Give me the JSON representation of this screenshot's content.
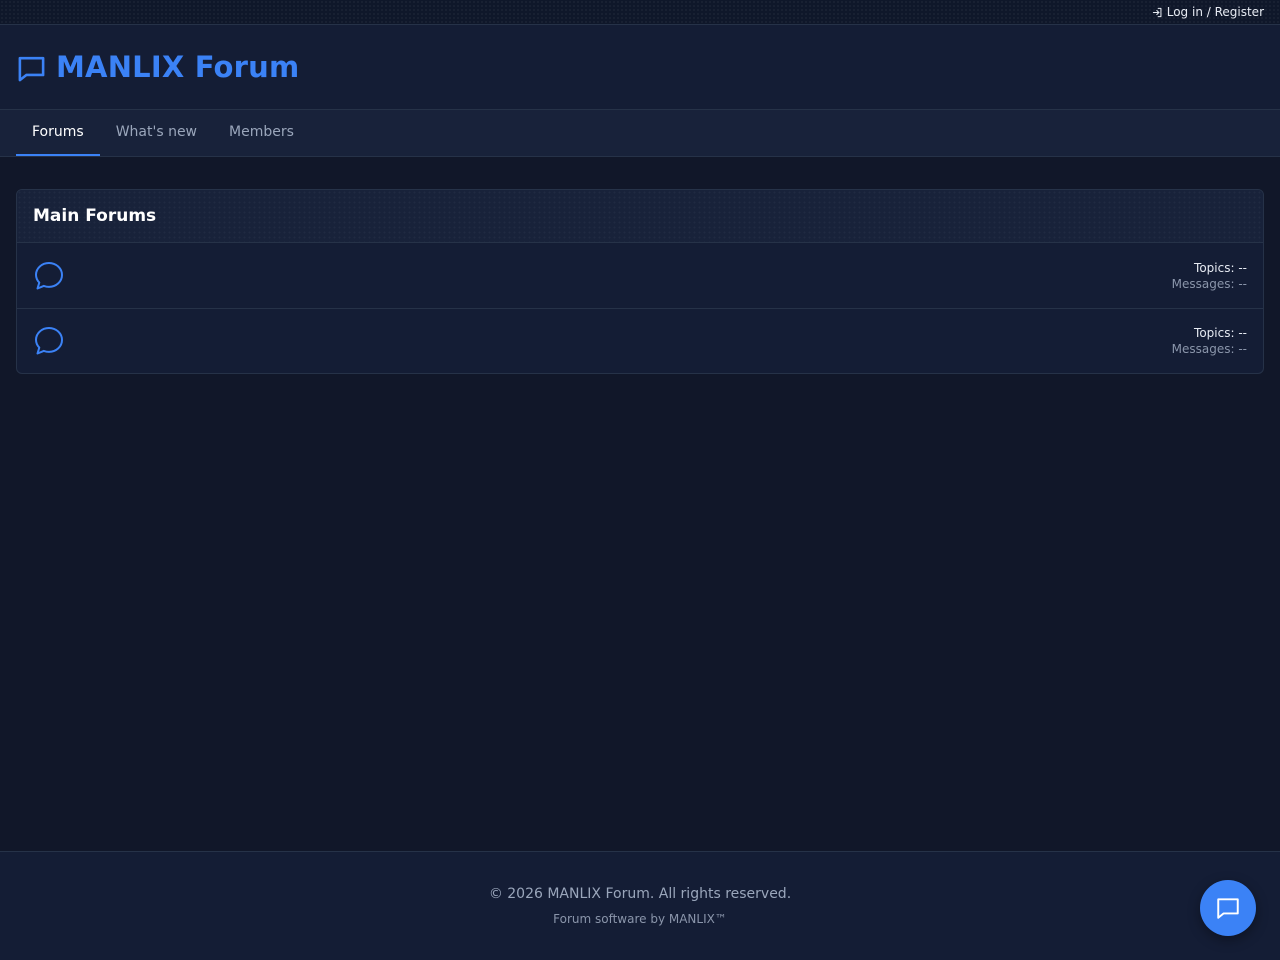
{
  "topbar": {
    "login_label": "Log in / Register",
    "login_icon": "login-icon"
  },
  "header": {
    "site_title": "MANLIX Forum",
    "logo_icon": "chat-bubble-icon",
    "brand_color": "#3b82f6"
  },
  "nav": {
    "tabs": [
      {
        "label": "Forums",
        "active": true
      },
      {
        "label": "What's new",
        "active": false
      },
      {
        "label": "Members",
        "active": false
      }
    ]
  },
  "main": {
    "section_title": "Main Forums",
    "forums": [
      {
        "icon": "chat-bubble-icon",
        "topics": "Topics: --",
        "messages": "Messages: --"
      },
      {
        "icon": "chat-bubble-icon",
        "topics": "Topics: --",
        "messages": "Messages: --"
      }
    ]
  },
  "footer": {
    "copyright": "© 2026 MANLIX Forum. All rights reserved.",
    "credit": "Forum software by MANLIX™"
  },
  "chat_button": {
    "icon": "chat-icon",
    "color": "#3b82f6"
  }
}
